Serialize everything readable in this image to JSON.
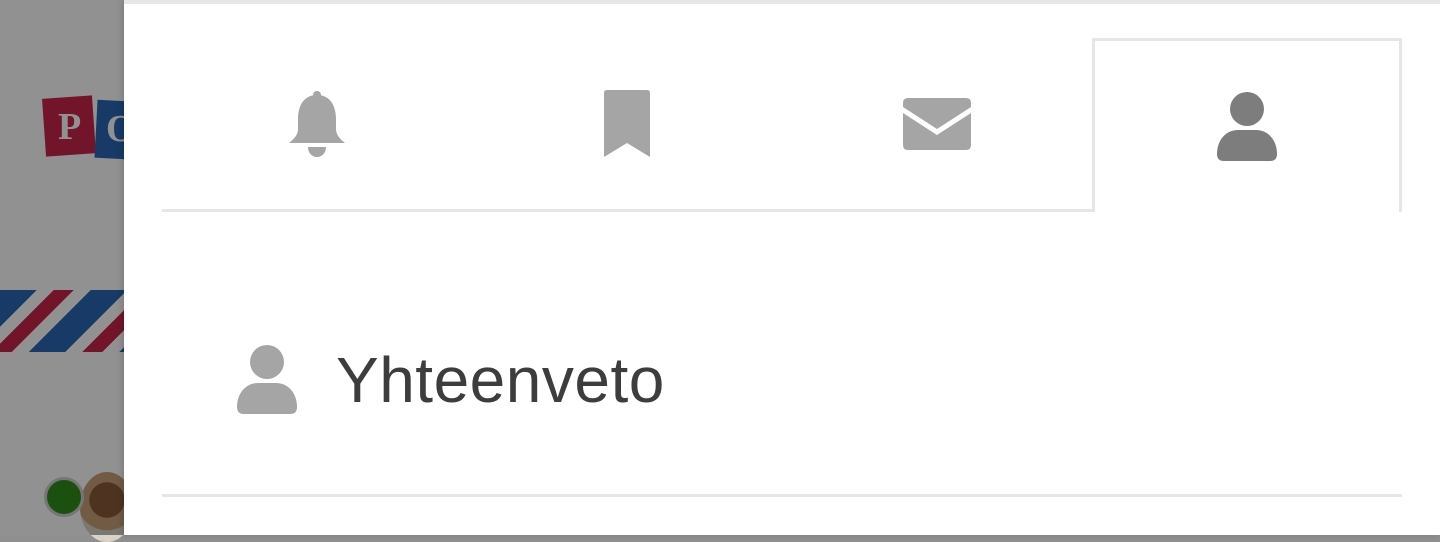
{
  "background": {
    "logo_letters": [
      "P",
      "O"
    ]
  },
  "drawer": {
    "tabs": [
      {
        "name": "notifications",
        "icon": "bell-icon",
        "active": false
      },
      {
        "name": "bookmarks",
        "icon": "bookmark-icon",
        "active": false
      },
      {
        "name": "messages",
        "icon": "envelope-icon",
        "active": false
      },
      {
        "name": "profile",
        "icon": "user-icon",
        "active": true
      }
    ],
    "section": {
      "icon": "user-icon",
      "title": "Yhteenveto"
    }
  },
  "colors": {
    "icon_inactive": "#a5a5a5",
    "icon_active": "#7d7d7d",
    "title_text": "#3d3d3d",
    "divider": "#e6e6e6",
    "online_status": "#2f8f1c"
  }
}
